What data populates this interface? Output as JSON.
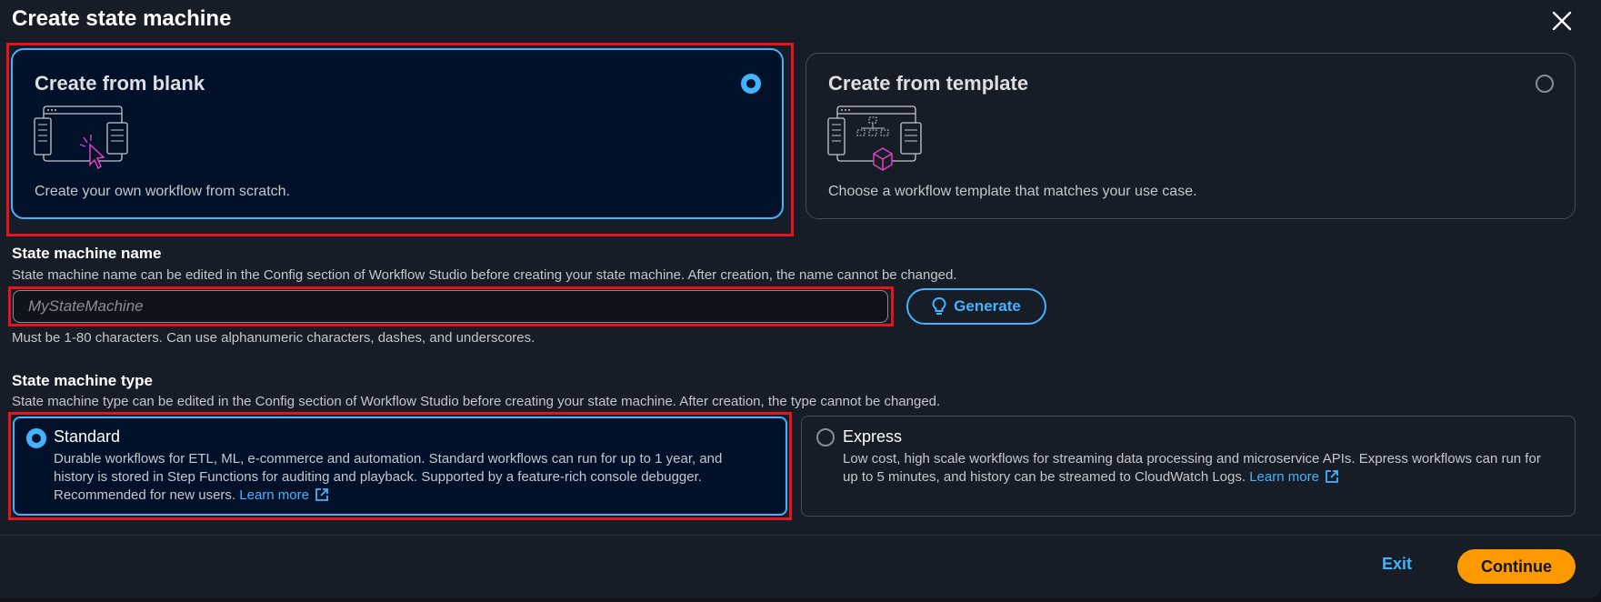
{
  "modal": {
    "title": "Create state machine"
  },
  "creation_options": {
    "blank": {
      "title": "Create from blank",
      "description": "Create your own workflow from scratch.",
      "selected": true
    },
    "template": {
      "title": "Create from template",
      "description": "Choose a workflow template that matches your use case.",
      "selected": false
    }
  },
  "name_field": {
    "label": "State machine name",
    "description": "State machine name can be edited in the Config section of Workflow Studio before creating your state machine. After creation, the name cannot be changed.",
    "placeholder": "MyStateMachine",
    "value": "",
    "constraint": "Must be 1-80 characters. Can use alphanumeric characters, dashes, and underscores.",
    "generate_label": "Generate"
  },
  "type_field": {
    "label": "State machine type",
    "description": "State machine type can be edited in the Config section of Workflow Studio before creating your state machine. After creation, the type cannot be changed.",
    "standard": {
      "title": "Standard",
      "desc_line1": "Durable workflows for ETL, ML, e-commerce and automation. Standard workflows can run for up to 1 year, and",
      "desc_line2": "history is stored in Step Functions for auditing and playback. Supported by a feature-rich console debugger.",
      "desc_line3": "Recommended for new users.",
      "link": "Learn more",
      "selected": true
    },
    "express": {
      "title": "Express",
      "desc_line1": "Low cost, high scale workflows for streaming data processing and microservice APIs. Express workflows can run for",
      "desc_line2": "up to 5 minutes, and history can be streamed to CloudWatch Logs.",
      "link": "Learn more",
      "selected": false
    }
  },
  "footer": {
    "exit_label": "Exit",
    "continue_label": "Continue"
  },
  "colors": {
    "accent": "#42b4ff",
    "primary_button": "#ff9900",
    "highlight": "#e8141d",
    "background": "#161d26"
  }
}
